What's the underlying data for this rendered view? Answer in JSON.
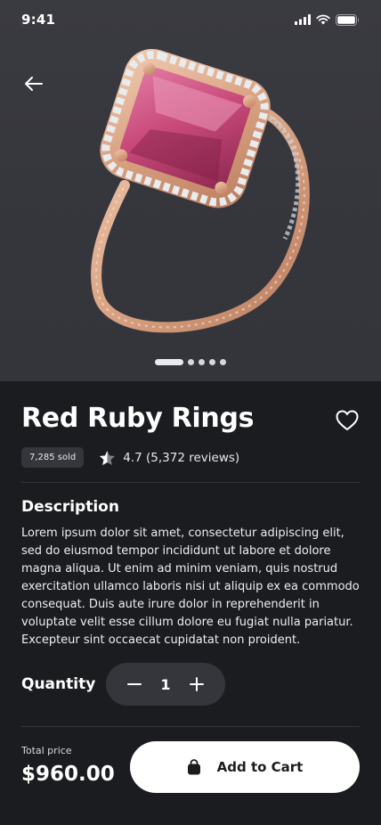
{
  "status_bar": {
    "time": "9:41",
    "icons": [
      "signal-icon",
      "wifi-icon",
      "battery-icon"
    ]
  },
  "hero": {
    "image": "red-ruby-ring-photo",
    "carousel": {
      "pages": 5,
      "active_index": 0
    }
  },
  "product": {
    "title": "Red Ruby Rings",
    "sold_badge": "7,285 sold",
    "rating_text": "4.7 (5,372 reviews)"
  },
  "description": {
    "heading": "Description",
    "body": "Lorem ipsum dolor sit amet, consectetur adipiscing elit, sed do eiusmod tempor incididunt ut labore et dolore magna aliqua. Ut enim ad minim veniam, quis nostrud exercitation ullamco laboris nisi ut aliquip ex ea commodo consequat. Duis aute irure dolor in reprehenderit in voluptate velit esse cillum dolore eu fugiat nulla pariatur. Excepteur sint occaecat cupidatat non proident."
  },
  "quantity": {
    "label": "Quantity",
    "value": "1"
  },
  "footer": {
    "total_label": "Total price",
    "total_value": "$960.00",
    "cart_button": "Add to Cart"
  },
  "colors": {
    "background": "#1b1c20",
    "hero_background": "#37383e",
    "surface": "#35363c",
    "button_bg": "#ffffff",
    "button_text": "#1b1c20",
    "gem": "#c94a7a",
    "gold": "#dcae90"
  }
}
